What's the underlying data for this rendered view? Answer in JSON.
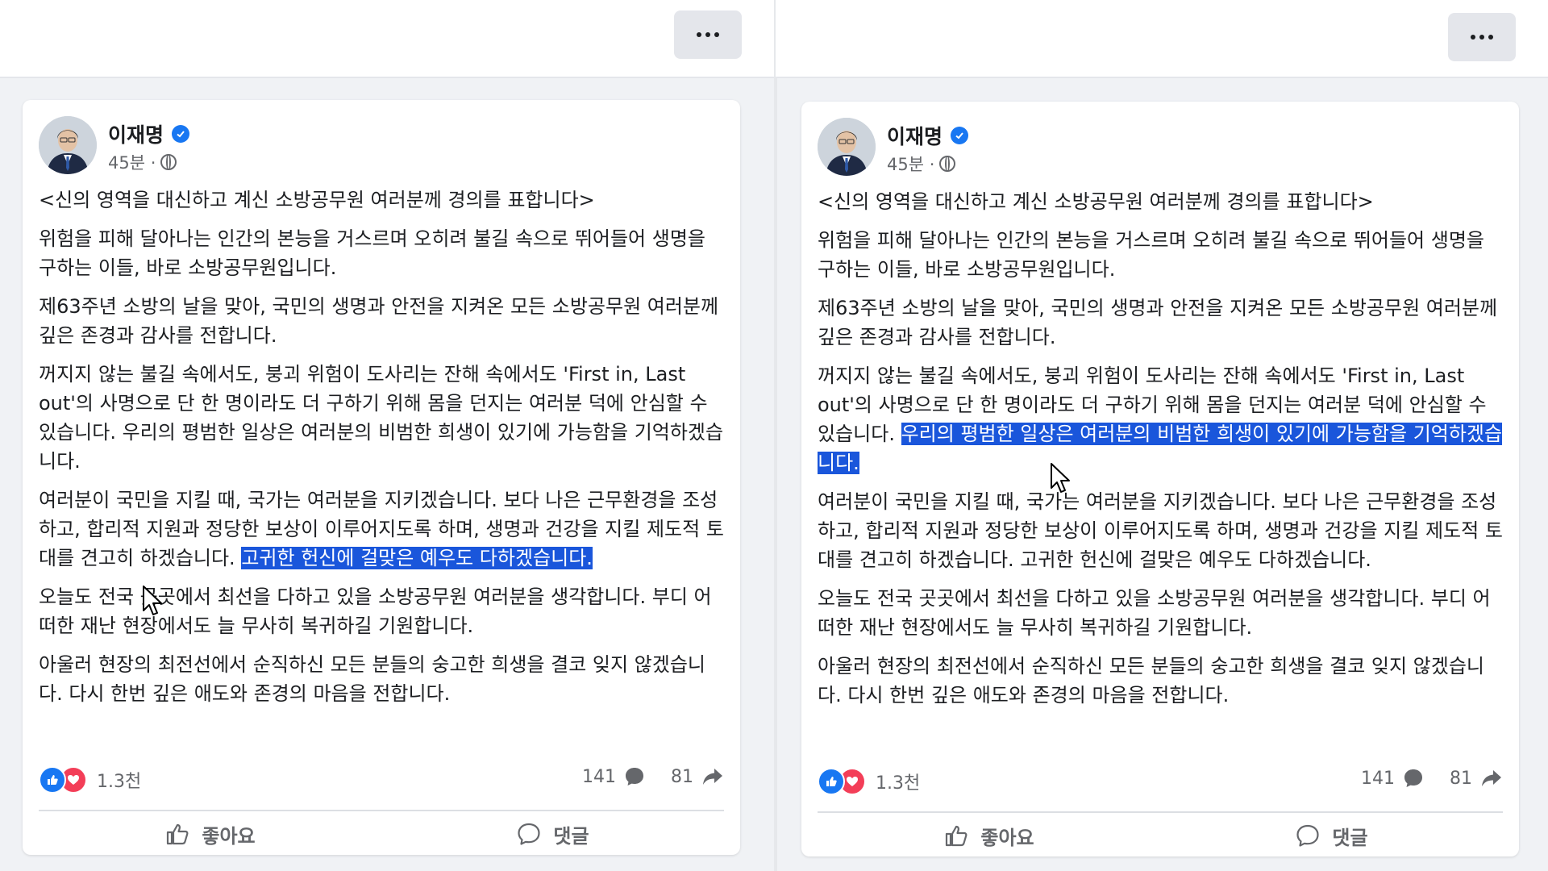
{
  "more_label": "…",
  "posts": [
    {
      "author": "이재명",
      "time": "45분 ·",
      "title": "<신의 영역을 대신하고 계신 소방공무원 여러분께 경의를 표합니다>",
      "p1": "위험을 피해 달아나는 인간의 본능을 거스르며 오히려 불길 속으로 뛰어들어 생명을 구하는 이들, 바로 소방공무원입니다.",
      "p2": "제63주년 소방의 날을 맞아, 국민의 생명과 안전을 지켜온 모든 소방공무원 여러분께 깊은 존경과 감사를 전합니다.",
      "p3_a": "꺼지지 않는 불길 속에서도, 붕괴 위험이 도사리는 잔해 속에서도 'First in, Last out'의 사명으로 단 한 명이라도 더 구하기 위해 몸을 던지는 여러분 덕에 안심할 수 있습니다. ",
      "p3_b": "우리의 평범한 일상은 여러분의 비범한 희생이 있기에 가능함을 기억하겠습니다.",
      "p4_a": "여러분이 국민을 지킬 때, 국가는 여러분을 지키겠습니다. 보다 나은 근무환경을 조성하고, 합리적 지원과 정당한 보상이 이루어지도록 하며, 생명과 건강을 지킬 제도적 토대를 견고히 하겠습니다. ",
      "p4_b": "고귀한 헌신에 걸맞은 예우도 다하겠습니다.",
      "p5": "오늘도 전국 곳곳에서 최선을 다하고 있을 소방공무원 여러분을 생각합니다. 부디 어떠한 재난 현장에서도 늘 무사히 복귀하길 기원합니다.",
      "p6": "아울러 현장의 최전선에서 순직하신 모든 분들의 숭고한 희생을 결코 잊지 않겠습니다. 다시 한번 깊은 애도와 존경의 마음을 전합니다.",
      "reactions": "1.3천",
      "comments": "141",
      "shares": "81",
      "like_label": "좋아요",
      "comment_label": "댓글"
    },
    {
      "author": "이재명",
      "time": "45분 ·",
      "title": "<신의 영역을 대신하고 계신 소방공무원 여러분께 경의를 표합니다>",
      "p1": "위험을 피해 달아나는 인간의 본능을 거스르며 오히려 불길 속으로 뛰어들어 생명을 구하는 이들, 바로 소방공무원입니다.",
      "p2": "제63주년 소방의 날을 맞아, 국민의 생명과 안전을 지켜온 모든 소방공무원 여러분께 깊은 존경과 감사를 전합니다.",
      "p3_a": "꺼지지 않는 불길 속에서도, 붕괴 위험이 도사리는 잔해 속에서도 'First in, Last out'의 사명으로 단 한 명이라도 더 구하기 위해 몸을 던지는 여러분 덕에 안심할 수 있습니다. ",
      "p3_b": "우리의 평범한 일상은 여러분의 비범한 희생이 있기에 가능함을 기억하겠습니다.",
      "p4_a": "여러분이 국민을 지킬 때, 국가는 여러분을 지키겠습니다. 보다 나은 근무환경을 조성하고, 합리적 지원과 정당한 보상이 이루어지도록 하며, 생명과 건강을 지킬 제도적 토대를 견고히 하겠습니다. ",
      "p4_b": "고귀한 헌신에 걸맞은 예우도 다하겠습니다.",
      "p5": "오늘도 전국 곳곳에서 최선을 다하고 있을 소방공무원 여러분을 생각합니다. 부디 어떠한 재난 현장에서도 늘 무사히 복귀하길 기원합니다.",
      "p6": "아울러 현장의 최전선에서 순직하신 모든 분들의 숭고한 희생을 결코 잊지 않겠습니다. 다시 한번 깊은 애도와 존경의 마음을 전합니다.",
      "reactions": "1.3천",
      "comments": "141",
      "shares": "81",
      "like_label": "좋아요",
      "comment_label": "댓글"
    }
  ],
  "icons": {
    "more": "more-dots-icon",
    "verified": "verified-badge-icon",
    "privacy": "globe-icon",
    "like_reaction": "like-reaction-icon",
    "love_reaction": "love-reaction-icon",
    "comment": "comment-bubble-icon",
    "share": "share-arrow-icon",
    "like_action": "thumbs-up-icon",
    "cursor": "mouse-pointer-icon"
  },
  "colors": {
    "highlight": "#1a56db",
    "brand_blue": "#1877f2",
    "love_red": "#f33e58",
    "page_bg": "#f0f2f5"
  },
  "highlighted_sentence": {
    "left_post": "p4_b",
    "right_post": "p3_b"
  }
}
